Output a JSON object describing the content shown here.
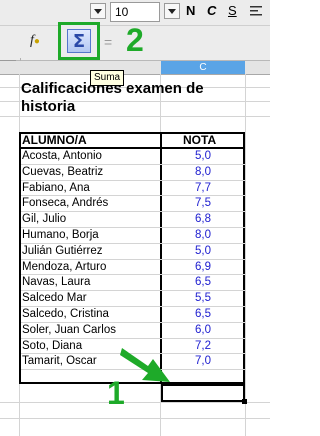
{
  "toolbar": {
    "font_size": "10",
    "bold_label": "N",
    "italic_label": "C",
    "underline_label": "S",
    "sum_symbol": "Σ",
    "sum_tooltip": "Suma",
    "fx_label": "f"
  },
  "annotations": {
    "callout_1": "1",
    "callout_2": "2",
    "accent_color": "#1eaa29"
  },
  "sheet": {
    "column_header_c": "C",
    "title": "Calificaciones examen de historia",
    "header_name": "ALUMNO/A",
    "header_grade": "NOTA",
    "grade_color": "#2020d0",
    "rows": [
      {
        "name": "Acosta, Antonio",
        "grade": "5,0"
      },
      {
        "name": "Cuevas, Beatriz",
        "grade": "8,0"
      },
      {
        "name": "Fabiano, Ana",
        "grade": "7,7"
      },
      {
        "name": "Fonseca, Andrés",
        "grade": "7,5"
      },
      {
        "name": "Gil, Julio",
        "grade": "6,8"
      },
      {
        "name": "Humano, Borja",
        "grade": "8,0"
      },
      {
        "name": "Julián Gutiérrez",
        "grade": "5,0"
      },
      {
        "name": "Mendoza, Arturo",
        "grade": "6,9"
      },
      {
        "name": "Navas, Laura",
        "grade": "6,5"
      },
      {
        "name": "Salcedo Mar",
        "grade": "5,5"
      },
      {
        "name": "Salcedo, Cristina",
        "grade": "6,5"
      },
      {
        "name": "Soler, Juan Carlos",
        "grade": "6,0"
      },
      {
        "name": "Soto, Diana",
        "grade": "7,2"
      },
      {
        "name": "Tamarit, Oscar",
        "grade": "7,0"
      }
    ]
  }
}
